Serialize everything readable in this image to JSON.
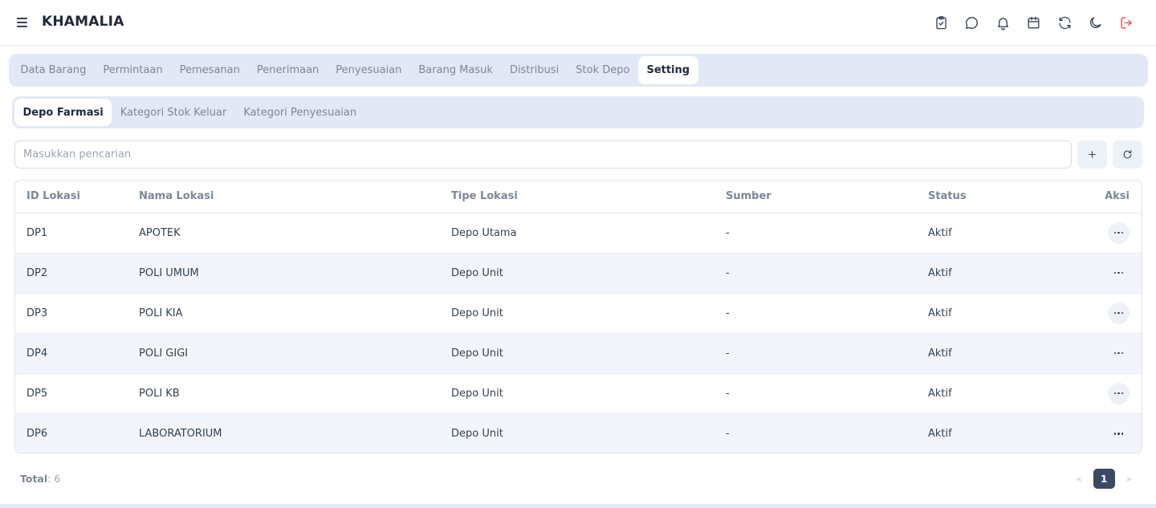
{
  "app": {
    "title": "KHAMALIA"
  },
  "header_icons": [
    "clipboard-check-icon",
    "chat-icon",
    "bell-icon",
    "calendar-icon",
    "refresh-icon",
    "moon-icon",
    "logout-icon"
  ],
  "main_tabs": [
    {
      "label": "Data Barang",
      "active": false
    },
    {
      "label": "Permintaan",
      "active": false
    },
    {
      "label": "Pemesanan",
      "active": false
    },
    {
      "label": "Penerimaan",
      "active": false
    },
    {
      "label": "Penyesuaian",
      "active": false
    },
    {
      "label": "Barang Masuk",
      "active": false
    },
    {
      "label": "Distribusi",
      "active": false
    },
    {
      "label": "Stok Depo",
      "active": false
    },
    {
      "label": "Setting",
      "active": true
    }
  ],
  "sub_tabs": [
    {
      "label": "Depo Farmasi",
      "active": true
    },
    {
      "label": "Kategori Stok Keluar",
      "active": false
    },
    {
      "label": "Kategori Penyesuaian",
      "active": false
    }
  ],
  "search": {
    "placeholder": "Masukkan pencarian",
    "value": ""
  },
  "table": {
    "headers": [
      "ID Lokasi",
      "Nama Lokasi",
      "Tipe Lokasi",
      "Sumber",
      "Status",
      "Aksi"
    ],
    "rows": [
      [
        "DP1",
        "APOTEK",
        "Depo Utama",
        "-",
        "Aktif"
      ],
      [
        "DP2",
        "POLI UMUM",
        "Depo Unit",
        "-",
        "Aktif"
      ],
      [
        "DP3",
        "POLI KIA",
        "Depo Unit",
        "-",
        "Aktif"
      ],
      [
        "DP4",
        "POLI GIGI",
        "Depo Unit",
        "-",
        "Aktif"
      ],
      [
        "DP5",
        "POLI KB",
        "Depo Unit",
        "-",
        "Aktif"
      ],
      [
        "DP6",
        "LABORATORIUM",
        "Depo Unit",
        "-",
        "Aktif"
      ]
    ]
  },
  "footer": {
    "total_label": "Total",
    "total_value": ": 6",
    "prev": "«",
    "page": "1",
    "next": "»"
  },
  "colors": {
    "accent": "#3b4a63",
    "tab_bg": "#e2e8f5",
    "logout": "#ef4444"
  }
}
